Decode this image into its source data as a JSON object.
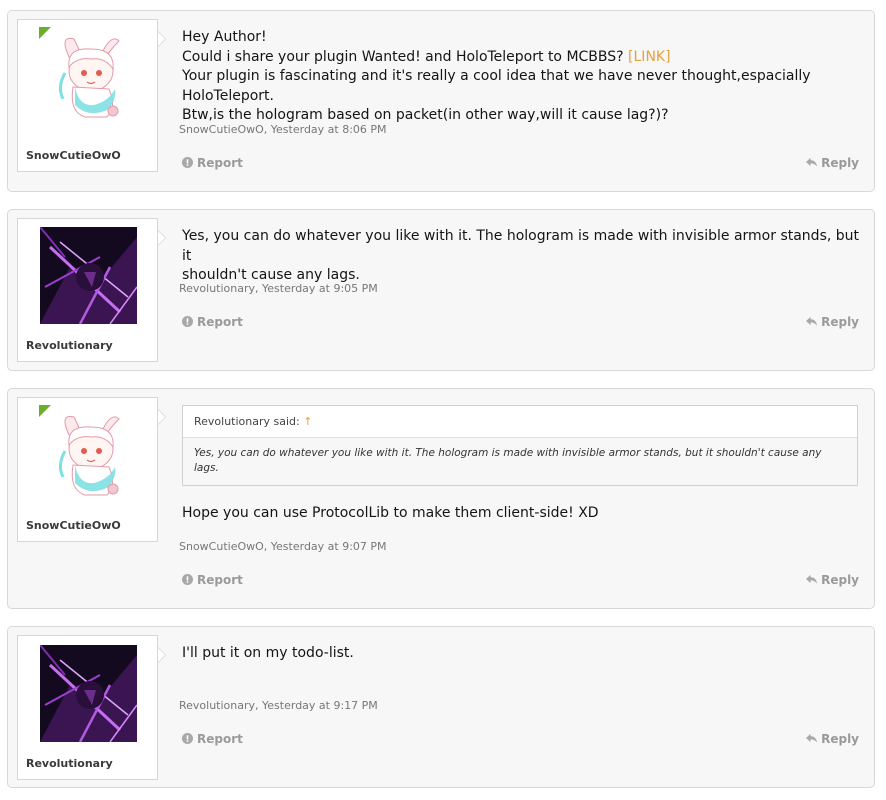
{
  "posts": [
    {
      "username": "SnowCutieOwO",
      "avatar": "anime-girl-avatar",
      "lines": [
        "Hey Author!",
        "Could i share your plugin Wanted! and HoloTeleport to MCBBS?",
        "Your plugin is fascinating and it's really a cool idea that we have never thought,espacially HoloTeleport.",
        "Btw,is the hologram based on packet(in other way,will it cause lag?)?"
      ],
      "link_text": "[LINK]",
      "meta": "SnowCutieOwO, Yesterday at 8:06 PM",
      "report": "Report",
      "reply": "Reply"
    },
    {
      "username": "Revolutionary",
      "avatar": "purple-warrior-avatar",
      "lines": [
        "Yes, you can do whatever you like with it. The hologram is made with invisible armor stands, but it",
        "shouldn't cause any lags."
      ],
      "meta": "Revolutionary, Yesterday at 9:05 PM",
      "report": "Report",
      "reply": "Reply"
    },
    {
      "username": "SnowCutieOwO",
      "avatar": "anime-girl-avatar",
      "quote": {
        "author": "Revolutionary said:",
        "arrow": "↑",
        "text": "Yes, you can do whatever you like with it. The hologram is made with invisible armor stands, but it shouldn't cause any lags."
      },
      "lines": [
        "Hope you can use ProtocolLib to make them client-side! XD"
      ],
      "meta": "SnowCutieOwO, Yesterday at 9:07 PM",
      "report": "Report",
      "reply": "Reply"
    },
    {
      "username": "Revolutionary",
      "avatar": "purple-warrior-avatar",
      "lines": [
        "I'll put it on my todo-list."
      ],
      "meta": "Revolutionary, Yesterday at 9:17 PM",
      "report": "Report",
      "reply": "Reply"
    }
  ],
  "colors": {
    "accent": "#e8a13a",
    "corner_badge": "#6aae2a",
    "post_bg": "#f7f7f7"
  }
}
